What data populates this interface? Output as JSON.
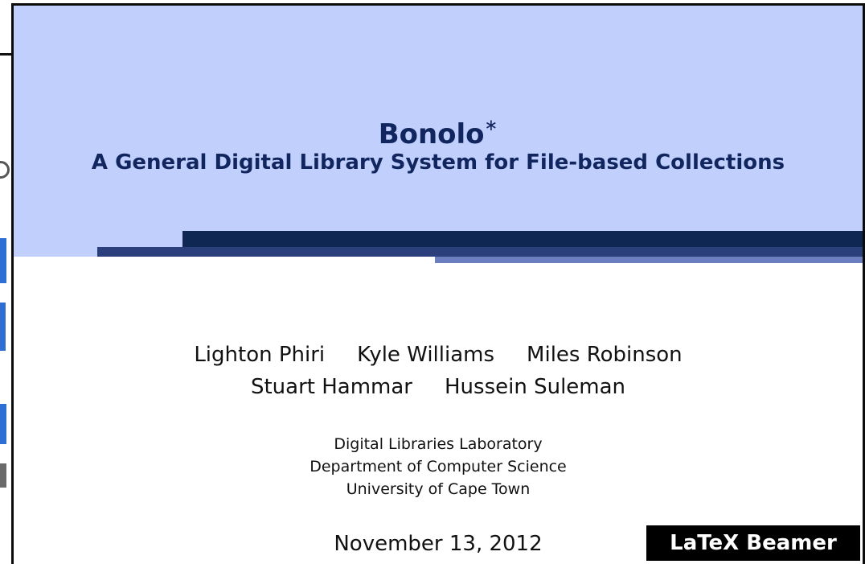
{
  "slide": {
    "title": "Bonolo",
    "title_mark": "∗",
    "subtitle": "A General Digital Library System for File-based Collections",
    "authors_line1": [
      "Lighton Phiri",
      "Kyle Williams",
      "Miles Robinson"
    ],
    "authors_line2": [
      "Stuart Hammar",
      "Hussein Suleman"
    ],
    "affiliation": [
      "Digital Libraries Laboratory",
      "Department of Computer Science",
      "University of Cape Town"
    ],
    "date": "November 13, 2012"
  },
  "badge": {
    "label": "LaTeX Beamer"
  },
  "colors": {
    "title_band": "#c0cffc",
    "title_text": "#11265e",
    "bar_dark": "#0f2753",
    "bar_mid": "#2a3f7c",
    "bar_light": "#6b7fc0"
  }
}
